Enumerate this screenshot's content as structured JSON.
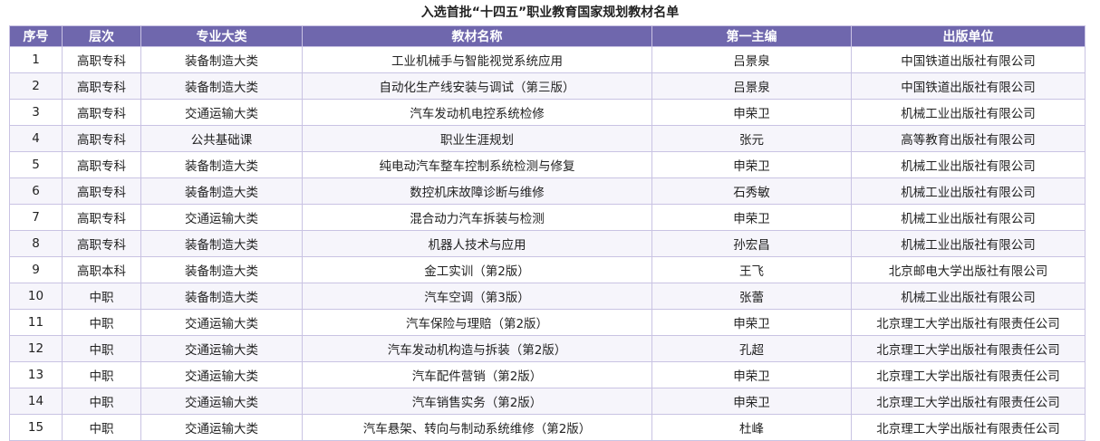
{
  "title": "入选首批“十四五”职业教育国家规划教材名单",
  "columns": [
    "序号",
    "层次",
    "专业大类",
    "教材名称",
    "第一主编",
    "出版单位"
  ],
  "rows": [
    [
      "1",
      "高职专科",
      "装备制造大类",
      "工业机械手与智能视觉系统应用",
      "吕景泉",
      "中国铁道出版社有限公司"
    ],
    [
      "2",
      "高职专科",
      "装备制造大类",
      "自动化生产线安装与调试（第三版）",
      "吕景泉",
      "中国铁道出版社有限公司"
    ],
    [
      "3",
      "高职专科",
      "交通运输大类",
      "汽车发动机电控系统检修",
      "申荣卫",
      "机械工业出版社有限公司"
    ],
    [
      "4",
      "高职专科",
      "公共基础课",
      "职业生涯规划",
      "张元",
      "高等教育出版社有限公司"
    ],
    [
      "5",
      "高职专科",
      "装备制造大类",
      "纯电动汽车整车控制系统检测与修复",
      "申荣卫",
      "机械工业出版社有限公司"
    ],
    [
      "6",
      "高职专科",
      "装备制造大类",
      "数控机床故障诊断与维修",
      "石秀敏",
      "机械工业出版社有限公司"
    ],
    [
      "7",
      "高职专科",
      "交通运输大类",
      "混合动力汽车拆装与检测",
      "申荣卫",
      "机械工业出版社有限公司"
    ],
    [
      "8",
      "高职专科",
      "装备制造大类",
      "机器人技术与应用",
      "孙宏昌",
      "机械工业出版社有限公司"
    ],
    [
      "9",
      "高职本科",
      "装备制造大类",
      "金工实训（第2版）",
      "王飞",
      "北京邮电大学出版社有限公司"
    ],
    [
      "10",
      "中职",
      "装备制造大类",
      "汽车空调（第3版）",
      "张蕾",
      "机械工业出版社有限公司"
    ],
    [
      "11",
      "中职",
      "交通运输大类",
      "汽车保险与理赔（第2版）",
      "申荣卫",
      "北京理工大学出版社有限责任公司"
    ],
    [
      "12",
      "中职",
      "交通运输大类",
      "汽车发动机构造与拆装（第2版）",
      "孔超",
      "北京理工大学出版社有限责任公司"
    ],
    [
      "13",
      "中职",
      "交通运输大类",
      "汽车配件营销（第2版）",
      "申荣卫",
      "北京理工大学出版社有限责任公司"
    ],
    [
      "14",
      "中职",
      "交通运输大类",
      "汽车销售实务（第2版）",
      "申荣卫",
      "北京理工大学出版社有限责任公司"
    ],
    [
      "15",
      "中职",
      "交通运输大类",
      "汽车悬架、转向与制动系统维修（第2版）",
      "杜峰",
      "北京理工大学出版社有限责任公司"
    ]
  ],
  "colors": {
    "header_bg": "#6f67ad",
    "header_text": "#ffffff",
    "border": "#c9c3e3"
  }
}
